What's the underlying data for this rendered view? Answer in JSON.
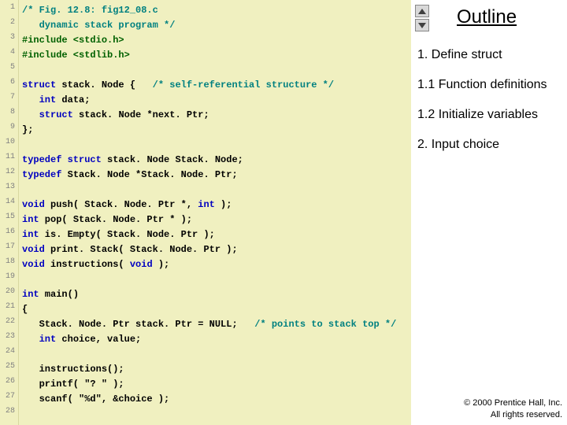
{
  "side": {
    "title": "Outline",
    "items": [
      "1. Define struct",
      "1.1 Function definitions",
      "1.2 Initialize variables",
      "2. Input choice"
    ],
    "copyright_line1": "© 2000 Prentice Hall, Inc.",
    "copyright_line2": "All rights reserved."
  },
  "code": {
    "lines": [
      {
        "n": "1",
        "segs": [
          {
            "cls": "c-comment",
            "t": "/* Fig. 12.8: fig12_08.c"
          }
        ]
      },
      {
        "n": "2",
        "segs": [
          {
            "cls": "c-comment",
            "t": "   dynamic stack program */"
          }
        ]
      },
      {
        "n": "3",
        "segs": [
          {
            "cls": "c-pre",
            "t": "#include <stdio.h>"
          }
        ]
      },
      {
        "n": "4",
        "segs": [
          {
            "cls": "c-pre",
            "t": "#include <stdlib.h>"
          }
        ]
      },
      {
        "n": "5",
        "segs": [
          {
            "cls": "c-plain",
            "t": ""
          }
        ]
      },
      {
        "n": "6",
        "segs": [
          {
            "cls": "c-kw",
            "t": "struct"
          },
          {
            "cls": "c-plain",
            "t": " stack. Node {   "
          },
          {
            "cls": "c-comment",
            "t": "/* self-referential structure */"
          }
        ]
      },
      {
        "n": "7",
        "segs": [
          {
            "cls": "c-plain",
            "t": "   "
          },
          {
            "cls": "c-kw",
            "t": "int"
          },
          {
            "cls": "c-plain",
            "t": " data;"
          }
        ]
      },
      {
        "n": "8",
        "segs": [
          {
            "cls": "c-plain",
            "t": "   "
          },
          {
            "cls": "c-kw",
            "t": "struct"
          },
          {
            "cls": "c-plain",
            "t": " stack. Node *next. Ptr;"
          }
        ]
      },
      {
        "n": "9",
        "segs": [
          {
            "cls": "c-plain",
            "t": "};"
          }
        ]
      },
      {
        "n": "10",
        "segs": [
          {
            "cls": "c-plain",
            "t": ""
          }
        ]
      },
      {
        "n": "11",
        "segs": [
          {
            "cls": "c-kw",
            "t": "typedef struct"
          },
          {
            "cls": "c-plain",
            "t": " stack. Node Stack. Node;"
          }
        ]
      },
      {
        "n": "12",
        "segs": [
          {
            "cls": "c-kw",
            "t": "typedef"
          },
          {
            "cls": "c-plain",
            "t": " Stack. Node *Stack. Node. Ptr;"
          }
        ]
      },
      {
        "n": "13",
        "segs": [
          {
            "cls": "c-plain",
            "t": ""
          }
        ]
      },
      {
        "n": "14",
        "segs": [
          {
            "cls": "c-kw",
            "t": "void"
          },
          {
            "cls": "c-plain",
            "t": " push( Stack. Node. Ptr *, "
          },
          {
            "cls": "c-kw",
            "t": "int"
          },
          {
            "cls": "c-plain",
            "t": " );"
          }
        ]
      },
      {
        "n": "15",
        "segs": [
          {
            "cls": "c-kw",
            "t": "int"
          },
          {
            "cls": "c-plain",
            "t": " pop( Stack. Node. Ptr * );"
          }
        ]
      },
      {
        "n": "16",
        "segs": [
          {
            "cls": "c-kw",
            "t": "int"
          },
          {
            "cls": "c-plain",
            "t": " is. Empty( Stack. Node. Ptr );"
          }
        ]
      },
      {
        "n": "17",
        "segs": [
          {
            "cls": "c-kw",
            "t": "void"
          },
          {
            "cls": "c-plain",
            "t": " print. Stack( Stack. Node. Ptr );"
          }
        ]
      },
      {
        "n": "18",
        "segs": [
          {
            "cls": "c-kw",
            "t": "void"
          },
          {
            "cls": "c-plain",
            "t": " instructions( "
          },
          {
            "cls": "c-kw",
            "t": "void"
          },
          {
            "cls": "c-plain",
            "t": " );"
          }
        ]
      },
      {
        "n": "19",
        "segs": [
          {
            "cls": "c-plain",
            "t": ""
          }
        ]
      },
      {
        "n": "20",
        "segs": [
          {
            "cls": "c-kw",
            "t": "int"
          },
          {
            "cls": "c-plain",
            "t": " main()"
          }
        ]
      },
      {
        "n": "21",
        "segs": [
          {
            "cls": "c-plain",
            "t": "{"
          }
        ]
      },
      {
        "n": "22",
        "segs": [
          {
            "cls": "c-plain",
            "t": "   Stack. Node. Ptr stack. Ptr = NULL;   "
          },
          {
            "cls": "c-comment",
            "t": "/* points to stack top */"
          }
        ]
      },
      {
        "n": "23",
        "segs": [
          {
            "cls": "c-plain",
            "t": "   "
          },
          {
            "cls": "c-kw",
            "t": "int"
          },
          {
            "cls": "c-plain",
            "t": " choice, value;"
          }
        ]
      },
      {
        "n": "24",
        "segs": [
          {
            "cls": "c-plain",
            "t": ""
          }
        ]
      },
      {
        "n": "25",
        "segs": [
          {
            "cls": "c-plain",
            "t": "   instructions();"
          }
        ]
      },
      {
        "n": "26",
        "segs": [
          {
            "cls": "c-plain",
            "t": "   printf( \"? \" );"
          }
        ]
      },
      {
        "n": "27",
        "segs": [
          {
            "cls": "c-plain",
            "t": "   scanf( \"%d\", &choice );"
          }
        ]
      },
      {
        "n": "28",
        "segs": [
          {
            "cls": "c-plain",
            "t": ""
          }
        ]
      }
    ]
  }
}
